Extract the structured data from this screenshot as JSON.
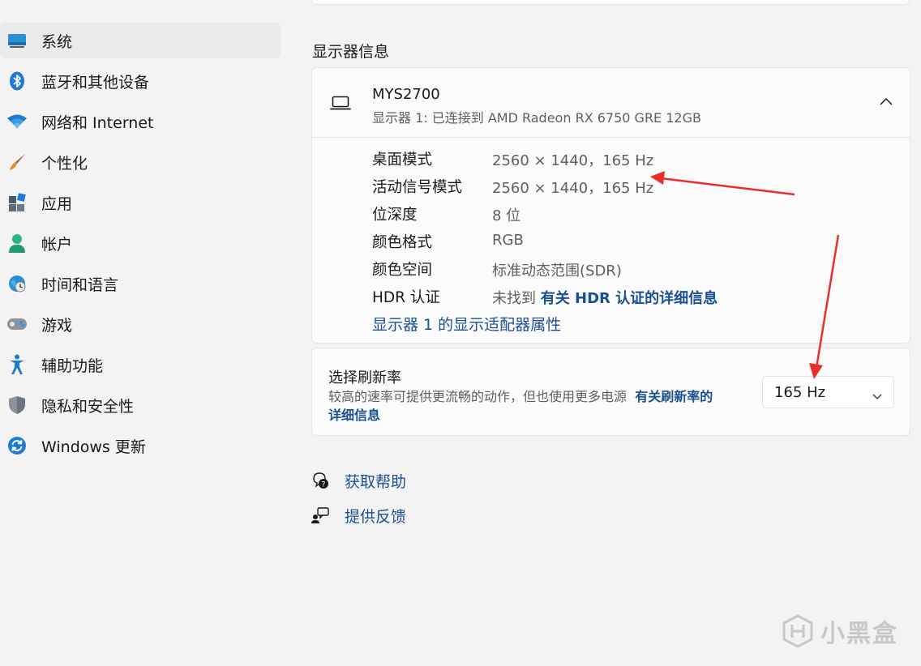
{
  "sidebar": {
    "items": [
      {
        "label": "系统",
        "icon": "system-display-icon",
        "active": true
      },
      {
        "label": "蓝牙和其他设备",
        "icon": "bluetooth-icon"
      },
      {
        "label": "网络和 Internet",
        "icon": "wifi-icon"
      },
      {
        "label": "个性化",
        "icon": "paintbrush-icon"
      },
      {
        "label": "应用",
        "icon": "apps-icon"
      },
      {
        "label": "帐户",
        "icon": "account-icon"
      },
      {
        "label": "时间和语言",
        "icon": "time-language-icon"
      },
      {
        "label": "游戏",
        "icon": "gamepad-icon"
      },
      {
        "label": "辅助功能",
        "icon": "accessibility-icon"
      },
      {
        "label": "隐私和安全性",
        "icon": "shield-icon"
      },
      {
        "label": "Windows 更新",
        "icon": "windows-update-icon"
      }
    ]
  },
  "main": {
    "section_title": "显示器信息",
    "monitor": {
      "name": "MYS2700",
      "subtitle": "显示器 1: 已连接到 AMD Radeon RX 6750 GRE 12GB"
    },
    "rows": [
      {
        "label": "桌面模式",
        "value": "2560 × 1440，165 Hz"
      },
      {
        "label": "活动信号模式",
        "value": "2560 × 1440，165 Hz"
      },
      {
        "label": "位深度",
        "value": "8 位"
      },
      {
        "label": "颜色格式",
        "value": "RGB"
      },
      {
        "label": "颜色空间",
        "value": "标准动态范围(SDR)"
      },
      {
        "label": "HDR 认证",
        "value": "未找到",
        "link": "有关 HDR 认证的详细信息"
      }
    ],
    "adapter_link": "显示器 1 的显示适配器属性",
    "refresh": {
      "title": "选择刷新率",
      "description": "较高的速率可提供更流畅的动作，但也使用更多电源",
      "link_part1": "有关刷新率的",
      "link_part2": "详细信息",
      "selected": "165 Hz"
    },
    "help": {
      "get_help": "获取帮助",
      "feedback": "提供反馈"
    }
  },
  "watermark": {
    "text": "小黑盒"
  },
  "colors": {
    "link": "#1b4f91",
    "annotation_arrow": "#e8302a",
    "background": "#f3f3f3"
  }
}
